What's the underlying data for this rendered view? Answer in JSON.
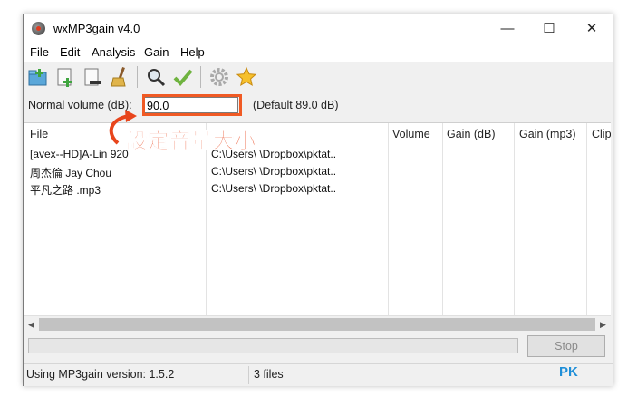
{
  "window": {
    "title": "wxMP3gain v4.0",
    "minimize": "—",
    "maximize": "☐",
    "close": "✕"
  },
  "menu": {
    "file": "File",
    "edit": "Edit",
    "analysis": "Analysis",
    "gain": "Gain",
    "help": "Help"
  },
  "toolbar": {
    "icons": [
      "add-folder-icon",
      "add-file-icon",
      "remove-file-icon",
      "clear-broom-icon",
      "analyze-magnifier-icon",
      "apply-gain-check-icon",
      "settings-gear-icon",
      "favorite-star-icon"
    ]
  },
  "volume": {
    "label": "Normal volume (dB):",
    "value": "90.0",
    "default_text": "(Default 89.0 dB)"
  },
  "list": {
    "columns": [
      "File",
      "",
      "Volume",
      "Gain (dB)",
      "Gain (mp3)",
      "Clip"
    ],
    "rows": [
      {
        "file": "[avex--HD]A-Lin 920",
        "path": "C:\\Users\\ \\Dropbox\\pktat.."
      },
      {
        "file": "周杰倫 Jay Chou",
        "path": "C:\\Users\\ \\Dropbox\\pktat.."
      },
      {
        "file": "平凡之路 .mp3",
        "path": "C:\\Users\\ \\Dropbox\\pktat.."
      }
    ]
  },
  "buttons": {
    "stop": "Stop"
  },
  "status": {
    "version": "Using MP3gain version: 1.5.2",
    "files": "3 files"
  },
  "annotation": {
    "text": "設定音量大小",
    "color": "#e8451c"
  },
  "watermark": {
    "text": "PK"
  },
  "colors": {
    "highlight_border": "#f05a24",
    "window_bg": "#f0f0f0"
  }
}
